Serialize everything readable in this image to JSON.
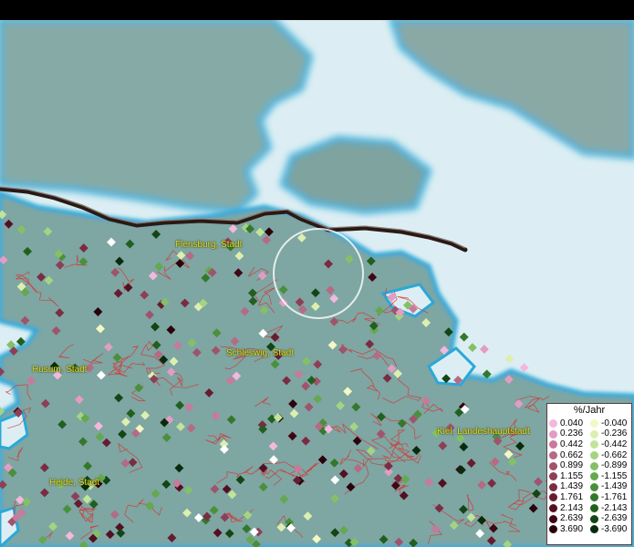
{
  "cities": [
    {
      "name": "Flensburg, Stadt"
    },
    {
      "name": "Schleswig, Stadt"
    },
    {
      "name": "Husum, Stadt"
    },
    {
      "name": "Heide, Stadt"
    },
    {
      "name": "Kiel, Landeshauptstadt"
    }
  ],
  "legend": {
    "title": "%/Jahr",
    "positive": [
      {
        "value": "0.040",
        "color": "#f2b8dd"
      },
      {
        "value": "0.236",
        "color": "#e39cc4"
      },
      {
        "value": "0.442",
        "color": "#c77a9b"
      },
      {
        "value": "0.662",
        "color": "#b56a85"
      },
      {
        "value": "0.899",
        "color": "#a0536c"
      },
      {
        "value": "1.155",
        "color": "#8d3f57"
      },
      {
        "value": "1.439",
        "color": "#7a2c43"
      },
      {
        "value": "1.761",
        "color": "#661c31"
      },
      {
        "value": "2.143",
        "color": "#531022"
      },
      {
        "value": "2.639",
        "color": "#3f0717"
      },
      {
        "value": "3.690",
        "color": "#2a020c"
      }
    ],
    "negative": [
      {
        "value": "-0.040",
        "color": "#f4f7c6"
      },
      {
        "value": "-0.236",
        "color": "#dcefb0"
      },
      {
        "value": "-0.442",
        "color": "#c2e499"
      },
      {
        "value": "-0.662",
        "color": "#a4d481"
      },
      {
        "value": "-0.899",
        "color": "#84c067"
      },
      {
        "value": "-1.155",
        "color": "#64a84f"
      },
      {
        "value": "-1.439",
        "color": "#4a903b"
      },
      {
        "value": "-1.761",
        "color": "#34782c"
      },
      {
        "value": "-2.143",
        "color": "#215f1f"
      },
      {
        "value": "-2.639",
        "color": "#134515"
      },
      {
        "value": "-3.690",
        "color": "#072b0b"
      }
    ]
  },
  "colors": {
    "land": "#7ea6a2",
    "water": "#dceef3",
    "coast": "#2aa8d8",
    "border_line": "#3a2020",
    "district_lines": "#d83030",
    "city_label": "#e8e01c",
    "selection_circle": "#ffffff"
  }
}
